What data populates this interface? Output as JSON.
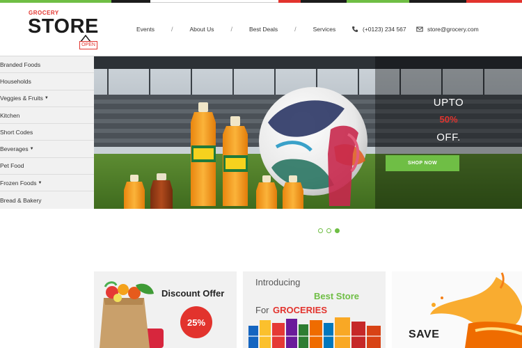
{
  "colors": {
    "accent_green": "#6fbe45",
    "accent_red": "#e2332d",
    "dark": "#1c1c1c"
  },
  "brand": {
    "small": "GROCERY",
    "big": "STORE",
    "tag": "OPEN"
  },
  "nav": {
    "items": [
      "Events",
      "About Us",
      "Best Deals",
      "Services"
    ],
    "separator": "/"
  },
  "contact": {
    "phone_icon": "phone-icon",
    "phone": "(+0123) 234 567",
    "email_icon": "envelope-icon",
    "email": "store@grocery.com"
  },
  "sidebar": {
    "items": [
      {
        "label": "Branded Foods",
        "dropdown": false
      },
      {
        "label": "Households",
        "dropdown": false
      },
      {
        "label": "Veggies & Fruits",
        "dropdown": true
      },
      {
        "label": "Kitchen",
        "dropdown": false
      },
      {
        "label": "Short Codes",
        "dropdown": false
      },
      {
        "label": "Beverages",
        "dropdown": true
      },
      {
        "label": "Pet Food",
        "dropdown": false
      },
      {
        "label": "Frozen Foods",
        "dropdown": true
      },
      {
        "label": "Bread & Bakery",
        "dropdown": false
      }
    ]
  },
  "hero": {
    "upto": "UPTO",
    "percent": "50%",
    "off": "OFF.",
    "button": "SHOP NOW"
  },
  "slider": {
    "count": 3,
    "active_index": 2
  },
  "banners": {
    "discount": {
      "title": "Discount Offer",
      "badge": "25%"
    },
    "introducing": {
      "line1": "Introducing",
      "line2": "Best Store",
      "line3_prefix": "For",
      "line3_highlight": "GROCERIES"
    },
    "save": {
      "title": "SAVE"
    }
  }
}
